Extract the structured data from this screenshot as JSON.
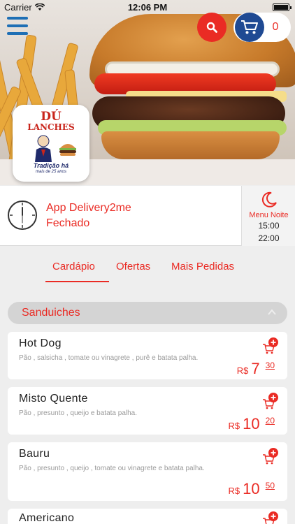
{
  "status_bar": {
    "carrier": "Carrier",
    "time": "12:06 PM"
  },
  "header": {
    "cart_count": "0"
  },
  "store": {
    "name": "App Delivery2me",
    "status": "Fechado"
  },
  "logo": {
    "brand_line1": "DÚ",
    "brand_line2": "LANCHES",
    "tagline": "Tradição há",
    "tagline2": "mais de 25 anos"
  },
  "shift": {
    "label": "Menu Noite",
    "open_time": "15:00",
    "close_time": "22:00"
  },
  "tabs": [
    {
      "label": "Cardápio",
      "active": true
    },
    {
      "label": "Ofertas",
      "active": false
    },
    {
      "label": "Mais Pedidas",
      "active": false
    }
  ],
  "category": {
    "name": "Sanduiches"
  },
  "currency": "R$",
  "products": [
    {
      "title": "Hot Dog",
      "description": "Pão , salsicha , tomate ou vinagrete , purê e batata palha.",
      "price_int": "7",
      "price_dec": "30"
    },
    {
      "title": "Misto Quente",
      "description": "Pão , presunto , queijo e batata palha.",
      "price_int": "10",
      "price_dec": "20"
    },
    {
      "title": "Bauru",
      "description": "Pão , presunto , queijo , tomate ou vinagrete e batata palha.",
      "price_int": "10",
      "price_dec": "50"
    },
    {
      "title": "Americano",
      "description": "",
      "price_int": "",
      "price_dec": ""
    }
  ],
  "colors": {
    "accent": "#ea2b24",
    "cart_blue": "#1f4a93",
    "menu_blue": "#1e6fb5"
  }
}
